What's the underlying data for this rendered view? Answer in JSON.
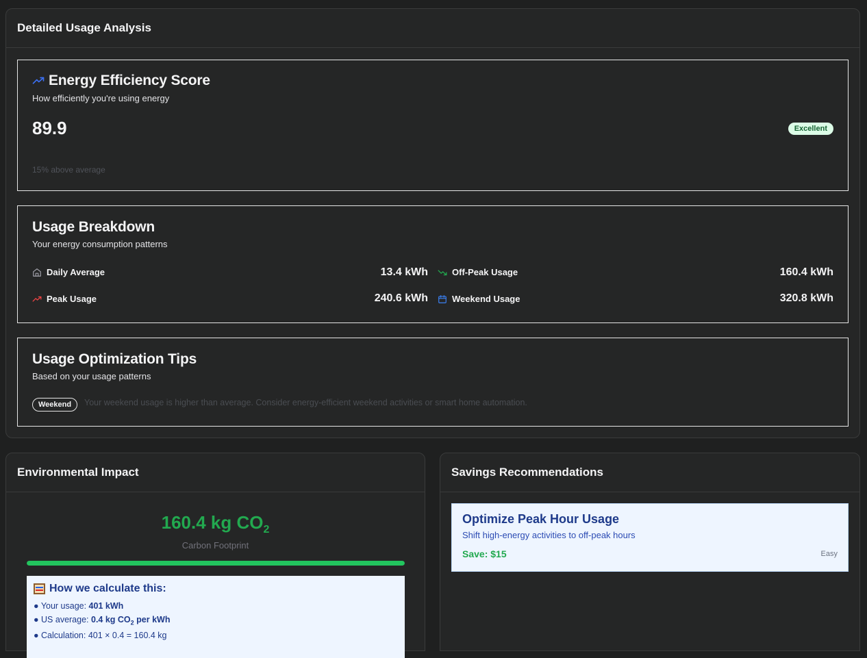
{
  "detailed": {
    "title": "Detailed Usage Analysis",
    "efficiency": {
      "title": "Energy Efficiency Score",
      "subtitle": "How efficiently you're using energy",
      "score": "89.9",
      "badge": "Excellent",
      "note": "15% above average"
    },
    "breakdown": {
      "title": "Usage Breakdown",
      "subtitle": "Your energy consumption patterns",
      "items": [
        {
          "label": "Daily Average",
          "value": "13.4 kWh",
          "icon": "home-icon"
        },
        {
          "label": "Off-Peak Usage",
          "value": "160.4 kWh",
          "icon": "trending-down-icon"
        },
        {
          "label": "Peak Usage",
          "value": "240.6 kWh",
          "icon": "trending-up-icon"
        },
        {
          "label": "Weekend Usage",
          "value": "320.8 kWh",
          "icon": "calendar-icon"
        }
      ]
    },
    "tips": {
      "title": "Usage Optimization Tips",
      "subtitle": "Based on your usage patterns",
      "tag": "Weekend",
      "text": "Your weekend usage is higher than average. Consider energy-efficient weekend activities or smart home automation."
    }
  },
  "environment": {
    "title": "Environmental Impact",
    "value": "160.4 kg CO",
    "value_sub": "2",
    "label": "Carbon Footprint",
    "progress": 1.0,
    "calc": {
      "title": "How we calculate this:",
      "lines": [
        {
          "label": "Your usage: ",
          "value": "401 kWh"
        },
        {
          "label": "US average: ",
          "value": "0.4 kg CO",
          "sub": "2",
          "tail": " per kWh"
        },
        {
          "label": "Calculation: 401 × 0.4 = 160.4 kg",
          "value": ""
        }
      ]
    }
  },
  "savings": {
    "title": "Savings Recommendations",
    "items": [
      {
        "title": "Optimize Peak Hour Usage",
        "desc": "Shift high-energy activities to off-peak hours",
        "save": "Save: $15",
        "difficulty": "Easy"
      }
    ]
  },
  "colors": {
    "accent_blue": "#3b6ff0",
    "green": "#22a94f",
    "red": "#ef4444",
    "badge_bg": "#dcfce7",
    "badge_text": "#166534",
    "calc_bg": "#eef5ff",
    "calc_text": "#1e3a8a"
  }
}
